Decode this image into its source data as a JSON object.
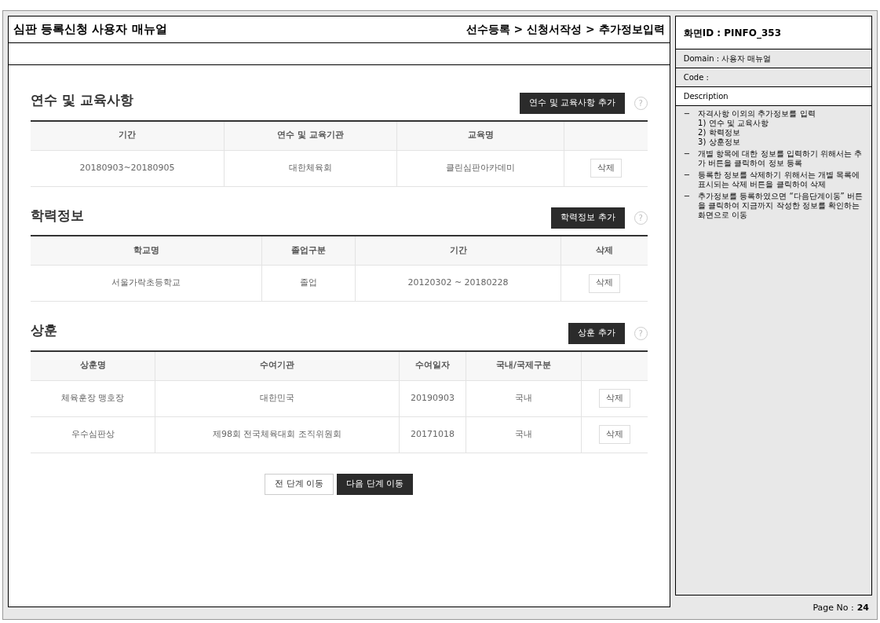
{
  "header": {
    "title": "심판 등록신청 사용자 매뉴얼",
    "breadcrumb": "선수등록 > 신청서작성 > 추가정보입력"
  },
  "sections": [
    {
      "title": "연수 및 교육사항",
      "add_button": "연수 및 교육사항 추가",
      "help": "?",
      "columns": [
        "기간",
        "연수 및 교육기관",
        "교육명"
      ],
      "rows": [
        {
          "cells": [
            "20180903~20180905",
            "대한체육회",
            "클린심판아카데미"
          ],
          "delete": "삭제"
        }
      ]
    },
    {
      "title": "학력정보",
      "add_button": "학력정보 추가",
      "help": "?",
      "columns": [
        "학교명",
        "졸업구분",
        "기간",
        "삭제"
      ],
      "rows": [
        {
          "cells": [
            "서울가락초등학교",
            "졸업",
            "20120302 ~ 20180228"
          ],
          "delete": "삭제"
        }
      ]
    },
    {
      "title": "상훈",
      "add_button": "상훈 추가",
      "help": "?",
      "columns": [
        "상훈명",
        "수여기관",
        "수여일자",
        "국내/국제구분"
      ],
      "rows": [
        {
          "cells": [
            "체육훈장 맹호장",
            "대한민국",
            "20190903",
            "국내"
          ],
          "delete": "삭제"
        },
        {
          "cells": [
            "우수심판상",
            "제98회 전국체육대회 조직위원회",
            "20171018",
            "국내"
          ],
          "delete": "삭제"
        }
      ]
    }
  ],
  "nav_buttons": [
    {
      "label": "전 단계 이동",
      "kind": "secondary"
    },
    {
      "label": "다음 단계 이동",
      "kind": "primary"
    }
  ],
  "side": {
    "screen_id": "화면ID : PINFO_353",
    "domain": "Domain : 사용자 매뉴얼",
    "code": "Code :",
    "description_label": "Description",
    "description": [
      {
        "text": "자격사항 이외의 추가정보를 입력",
        "children": [
          "1) 연수 및 교육사항",
          "2) 학력정보",
          "3) 상훈정보"
        ]
      },
      {
        "text": "개별 항목에 대한 정보를 입력하기 위해서는 추가 버튼을 클릭하여 정보 등록"
      },
      {
        "text": "등록한 정보를 삭제하기 위해서는 개별 목록에 표시되는 삭제 버튼을 클릭하여 삭제"
      },
      {
        "text": "추가정보를 등록하였으면 “다음단계이동” 버튼을 클릭하여 지금까지 작성한 정보를 확인하는 화면으로 이동"
      }
    ],
    "bullet": "−",
    "page_label": "Page No :",
    "page_number": "24"
  }
}
